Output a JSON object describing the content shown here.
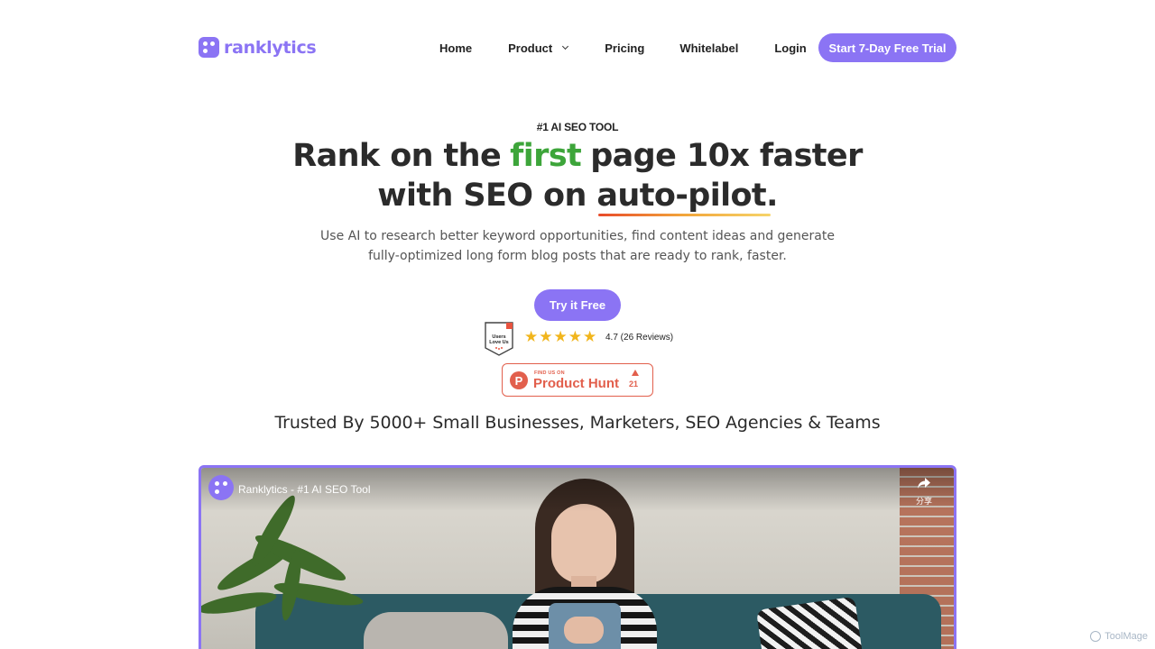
{
  "brand": {
    "name": "ranklytics",
    "color": "#8b74f4"
  },
  "nav": {
    "home": "Home",
    "product": "Product",
    "pricing": "Pricing",
    "whitelabel": "Whitelabel",
    "login": "Login",
    "cta": "Start 7-Day Free Trial"
  },
  "hero": {
    "eyebrow": "#1 AI SEO TOOL",
    "line1_pre": "Rank on the",
    "line1_highlight": "first",
    "line1_post": "page 10x faster",
    "line2_pre": "with SEO on",
    "line2_underlined": "auto-pilot.",
    "sub_line1": "Use AI to research better keyword opportunities, find content ideas and generate",
    "sub_line2": "fully-optimized long form blog posts that are ready to rank, faster.",
    "try_button": "Try it Free",
    "highlight_color": "#3da53a"
  },
  "reviews": {
    "badge_text_1": "Users",
    "badge_text_2": "Love Us",
    "stars": [
      "★",
      "★",
      "★",
      "★",
      "★"
    ],
    "rating_text": "4.7 (26 Reviews)",
    "star_color": "#f1b51c"
  },
  "product_hunt": {
    "find_label": "FIND US ON",
    "name": "Product Hunt",
    "logo_letter": "P",
    "upvotes": "21",
    "color": "#e25f4c"
  },
  "trusted": "Trusted By 5000+ Small Businesses, Marketers, SEO Agencies & Teams",
  "video": {
    "title": "Ranklytics - #1 AI SEO Tool",
    "share_label": "分享",
    "share_icon": "share-arrow-icon"
  },
  "watermark": "ToolMage"
}
